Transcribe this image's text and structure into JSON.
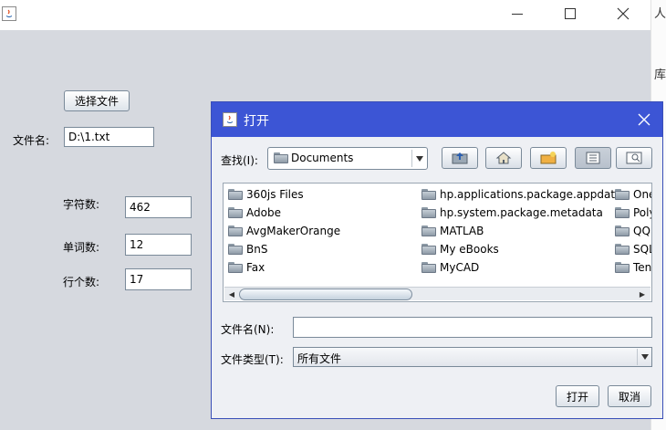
{
  "background_window": {
    "text_top": "人强",
    "text_mid": "库事"
  },
  "main_window": {
    "choose_file_button": "选择文件",
    "filename_label": "文件名:",
    "filename_value": "D:\\1.txt",
    "char_count_label": "字符数:",
    "char_count_value": "462",
    "word_count_label": "单词数:",
    "word_count_value": "12",
    "line_count_label": "行个数:",
    "line_count_value": "17"
  },
  "dialog": {
    "title": "打开",
    "look_in_label": "查找(I):",
    "look_in_value": "Documents",
    "files_col1": [
      "360js Files",
      "Adobe",
      "AvgMakerOrange",
      "BnS",
      "Fax"
    ],
    "files_col2": [
      "hp.applications.package.appdata",
      "hp.system.package.metadata",
      "MATLAB",
      "My eBooks",
      "MyCAD"
    ],
    "files_col3": [
      "One",
      "Poly",
      "QQ",
      "SQL",
      "Ten"
    ],
    "filename_label": "文件名(N):",
    "filename_value": "",
    "filetype_label": "文件类型(T):",
    "filetype_value": "所有文件",
    "open_button": "打开",
    "cancel_button": "取消"
  },
  "colors": {
    "dialog_title_bg": "#3c55d5",
    "panel_bg": "#d6d9df"
  }
}
